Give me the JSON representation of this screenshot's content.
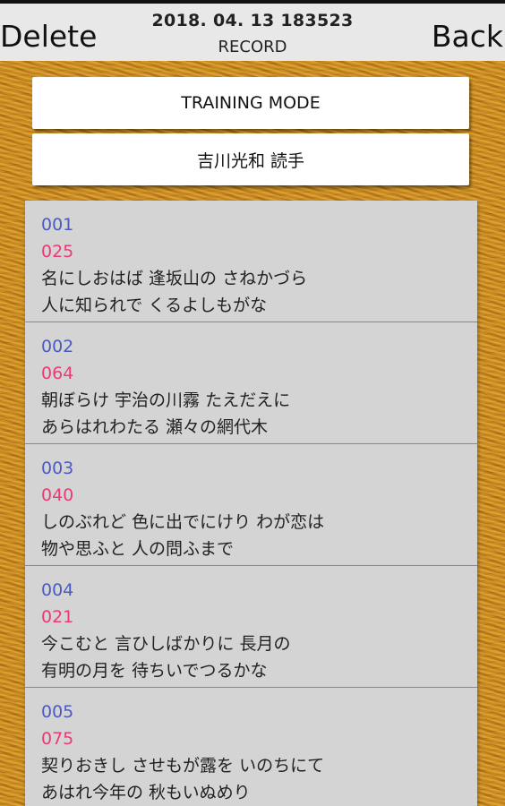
{
  "header": {
    "delete_label": "Delete",
    "back_label": "Back",
    "title": "2018. 04. 13 183523",
    "subtitle": "RECORD"
  },
  "mode_buttons": [
    "TRAINING MODE",
    "吉川光和 読手"
  ],
  "entries": [
    {
      "order": "001",
      "poem_no": "025",
      "line1": "名にしおはば 逢坂山の さねかづら",
      "line2": "人に知られで くるよしもがな"
    },
    {
      "order": "002",
      "poem_no": "064",
      "line1": "朝ぼらけ 宇治の川霧 たえだえに",
      "line2": "あらはれわたる 瀬々の網代木"
    },
    {
      "order": "003",
      "poem_no": "040",
      "line1": "しのぶれど 色に出でにけり わが恋は",
      "line2": "物や思ふと 人の問ふまで"
    },
    {
      "order": "004",
      "poem_no": "021",
      "line1": "今こむと 言ひしばかりに 長月の",
      "line2": "有明の月を 待ちいでつるかな"
    },
    {
      "order": "005",
      "poem_no": "075",
      "line1": "契りおきし させもが露を いのちにて",
      "line2": "あはれ今年の 秋もいぬめり"
    }
  ],
  "colors": {
    "order_number": "#4a5bbf",
    "poem_number": "#ea3a78",
    "list_background": "#d4d4d4",
    "wood_background": "#c98a1c"
  }
}
